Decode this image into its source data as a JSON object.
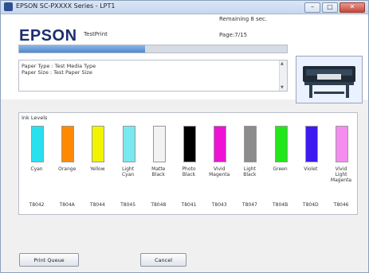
{
  "window": {
    "title": "EPSON SC-PXXXX Series - LPT1",
    "caption_buttons": [
      "–",
      "□",
      "✕"
    ]
  },
  "header": {
    "logo": "EPSON",
    "subtitle": "TestPrint",
    "remaining": "Remaining 8 sec.",
    "page": "Page:7/15",
    "progress": 0.47
  },
  "info": {
    "lines": [
      "Paper Type : Test Media Type",
      "Paper Size : Test Paper Size"
    ]
  },
  "ink_levels": {
    "label": "Ink Levels",
    "inks": [
      {
        "label": "Cyan",
        "code": "T8042",
        "color": "#29e0ee"
      },
      {
        "label": "Orange",
        "code": "T804A",
        "color": "#ff8a00"
      },
      {
        "label": "Yellow",
        "code": "T8044",
        "color": "#f3f300"
      },
      {
        "label": "Light\nCyan",
        "code": "T8045",
        "color": "#7ae8f0"
      },
      {
        "label": "Matte\nBlack",
        "code": "T8048",
        "color": "#f2f2f2"
      },
      {
        "label": "Photo\nBlack",
        "code": "T8041",
        "color": "#000000"
      },
      {
        "label": "Vivid\nMagenta",
        "code": "T8043",
        "color": "#ee12d7"
      },
      {
        "label": "Light\nBlack",
        "code": "T8047",
        "color": "#8c8c8c"
      },
      {
        "label": "Green",
        "code": "T804B",
        "color": "#22e61a"
      },
      {
        "label": "Violet",
        "code": "T804D",
        "color": "#3d1af0"
      },
      {
        "label": "Vivid\nLight\nMagenta",
        "code": "T8046",
        "color": "#f58cf0"
      }
    ]
  },
  "buttons": {
    "print_queue": "Print Queue",
    "cancel": "Cancel"
  }
}
